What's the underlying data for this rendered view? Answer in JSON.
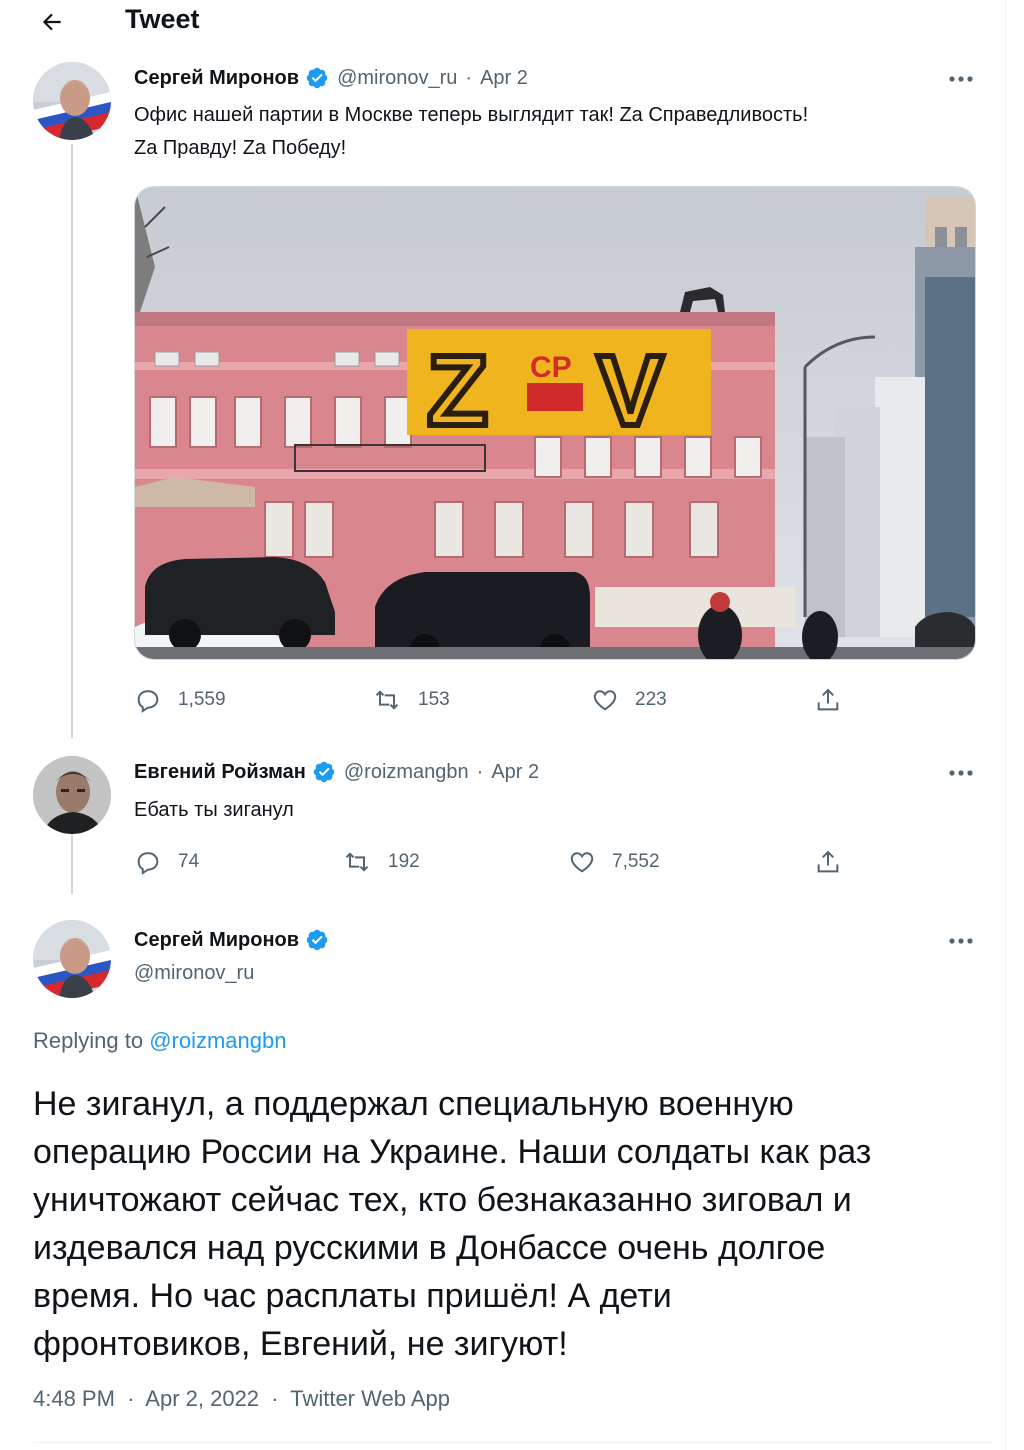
{
  "header": {
    "title": "Tweet"
  },
  "tweet1": {
    "display_name": "Сергей Миронов",
    "handle": "@mironov_ru",
    "date": "Apr 2",
    "text_line1": "Офис нашей партии в Москве теперь выглядит так! Zа Справедливость!",
    "text_line2": "Zа Правду! Zа Победу!",
    "banner": {
      "left_letter": "Z",
      "right_letter": "V",
      "logo": "СР"
    },
    "replies": "1,559",
    "retweets": "153",
    "likes": "223"
  },
  "tweet2": {
    "display_name": "Евгений Ройзман",
    "handle": "@roizmangbn",
    "date": "Apr 2",
    "text": "Ебать ты зиганул",
    "replies": "74",
    "retweets": "192",
    "likes": "7,552"
  },
  "main_tweet": {
    "display_name": "Сергей Миронов",
    "handle": "@mironov_ru",
    "replying_prefix": "Replying to",
    "replying_handle": "@roizmangbn",
    "text_lines": [
      "Не зиганул, а поддержал специальную военную",
      "операцию России на Украине. Наши солдаты как раз",
      "уничтожают сейчас тех, кто безнаказанно зиговал и",
      "издевался над русскими в Донбассе очень долгое",
      "время. Но час расплаты пришёл! А дети",
      "фронтовиков, Евгений, не зигуют!"
    ],
    "time": "4:48 PM",
    "date": "Apr 2, 2022",
    "source": "Twitter Web App"
  },
  "colors": {
    "accent": "#1d9bf0",
    "secondary_text": "#536471",
    "banner_yellow": "#f0b41e",
    "building_pink": "#d9868e"
  }
}
